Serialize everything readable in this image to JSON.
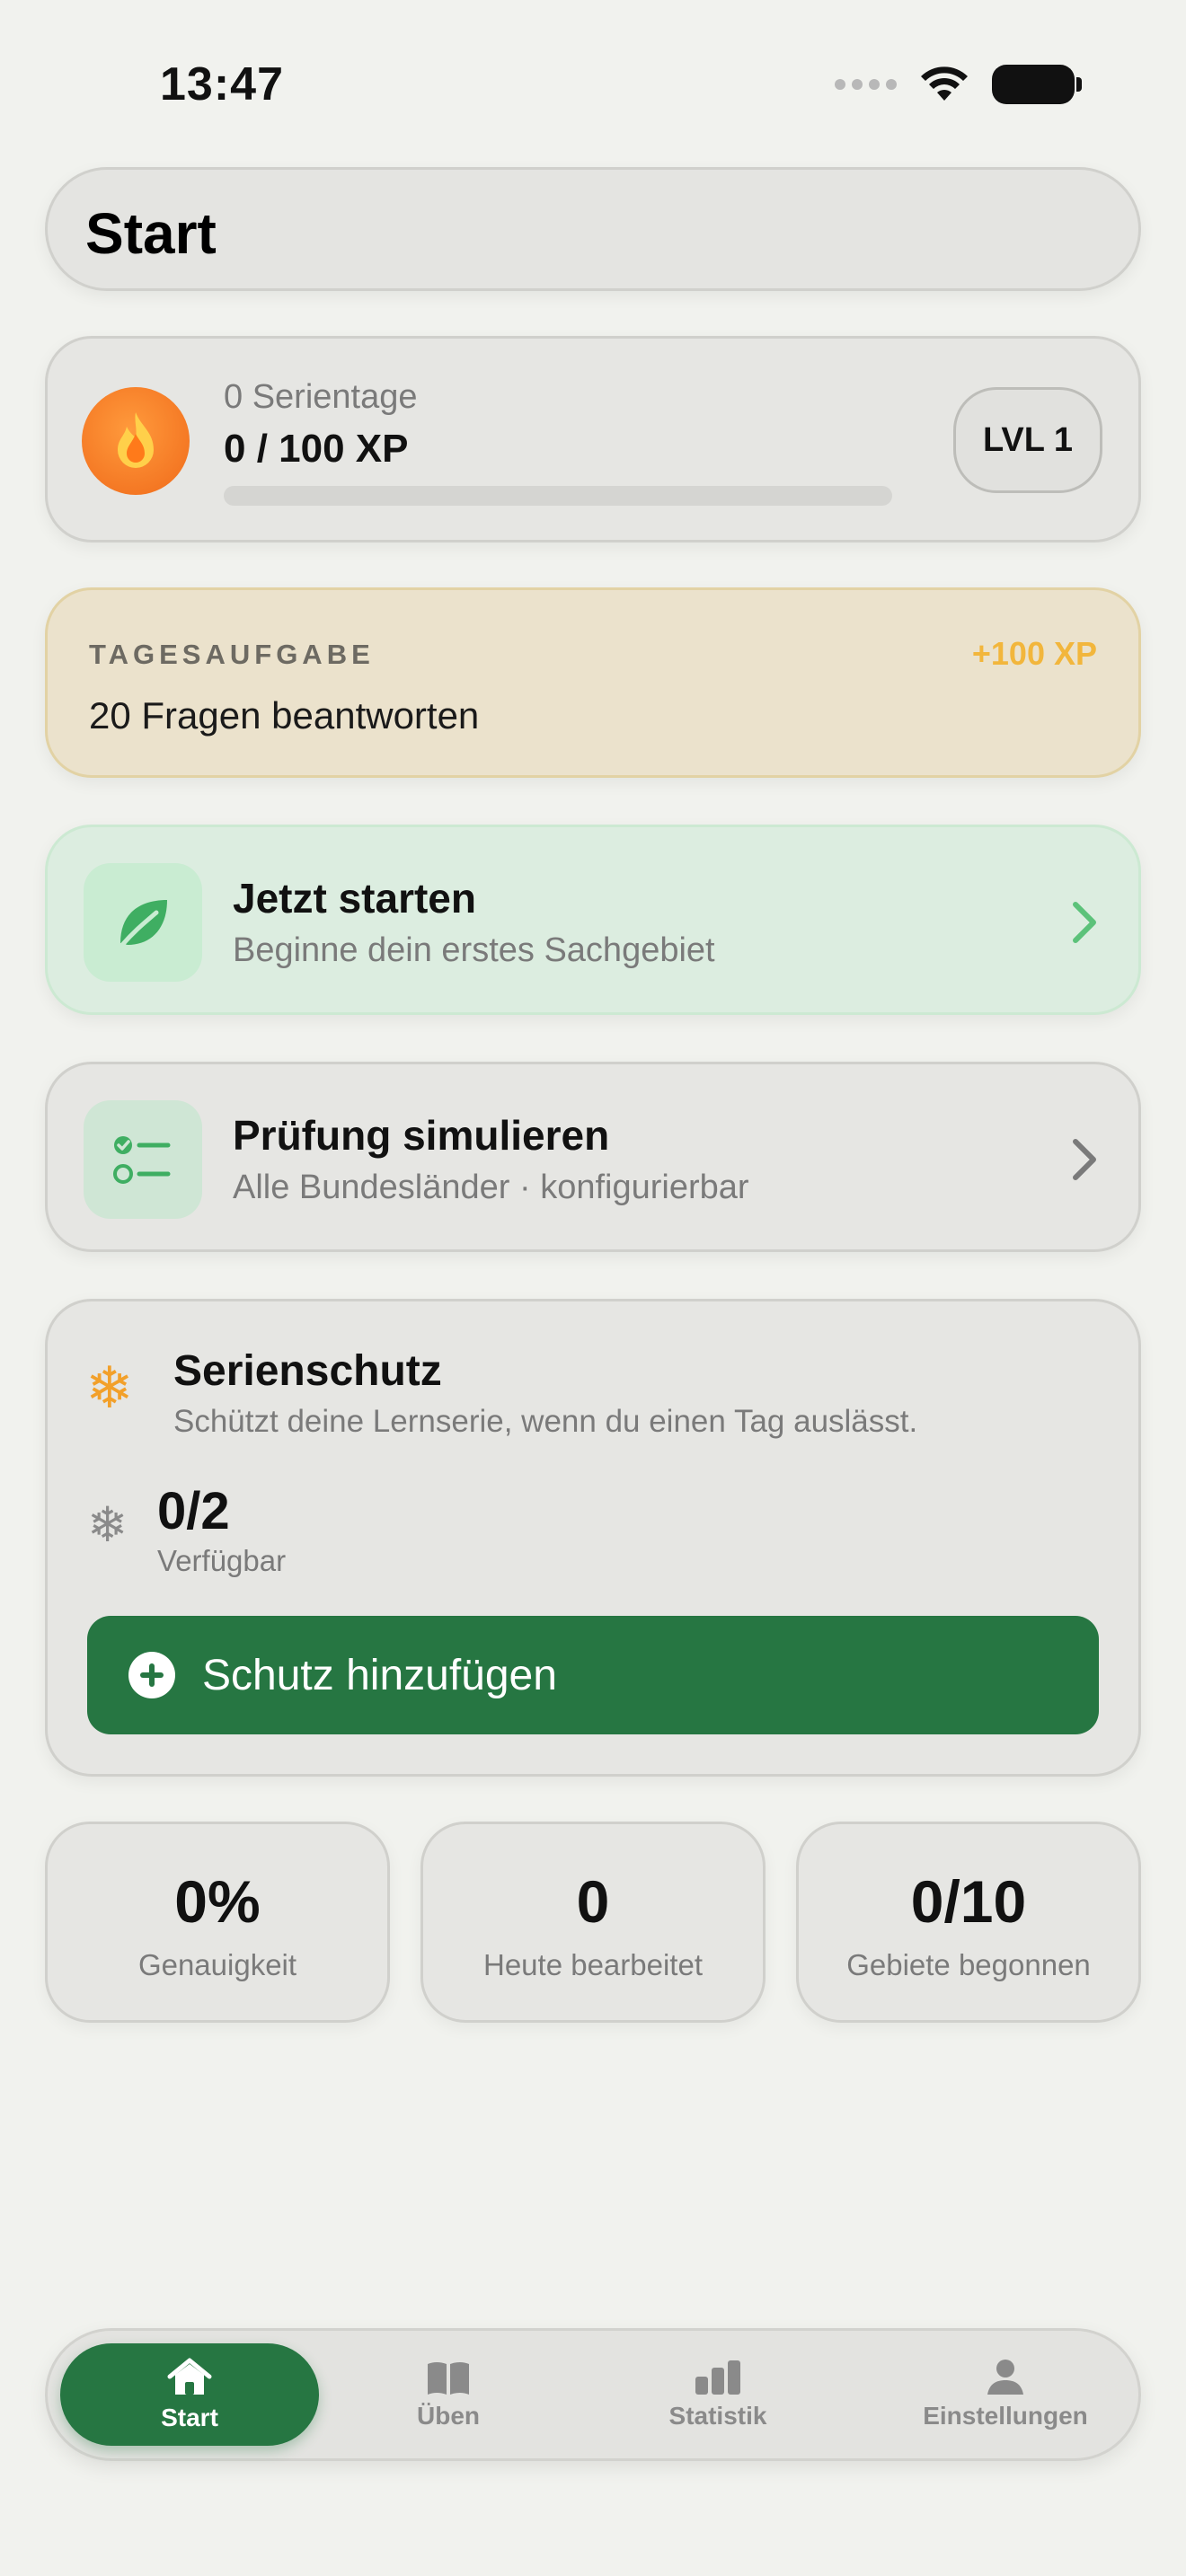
{
  "status_bar": {
    "time": "13:47"
  },
  "header": {
    "title": "Start"
  },
  "progress": {
    "streak_label": "0 Serientage",
    "xp_label": "0 / 100 XP",
    "xp_progress": 0,
    "level_label": "LVL 1"
  },
  "daily_task": {
    "eyebrow": "TAGESAUFGABE",
    "reward": "+100 XP",
    "title": "20 Fragen beantworten"
  },
  "start_now": {
    "title": "Jetzt starten",
    "subtitle": "Beginne dein erstes Sachgebiet",
    "icon": "leaf-icon"
  },
  "exam_sim": {
    "title": "Prüfung simulieren",
    "subtitle": "Alle Bundesländer · konfigurierbar",
    "icon": "checklist-icon"
  },
  "streak_freeze": {
    "title": "Serienschutz",
    "subtitle": "Schützt deine Lernserie, wenn du einen Tag auslässt.",
    "count": "0/2",
    "count_label": "Verfügbar",
    "button_label": "Schutz hinzufügen"
  },
  "stats": [
    {
      "value": "0%",
      "label": "Genauigkeit"
    },
    {
      "value": "0",
      "label": "Heute bearbeitet"
    },
    {
      "value": "0/10",
      "label": "Gebiete begonnen"
    }
  ],
  "tabbar": {
    "tabs": [
      {
        "label": "Start",
        "icon": "house-icon",
        "active": true
      },
      {
        "label": "Üben",
        "icon": "book-icon",
        "active": false
      },
      {
        "label": "Statistik",
        "icon": "bar-chart-icon",
        "active": false
      },
      {
        "label": "Einstellungen",
        "icon": "person-icon",
        "active": false
      }
    ]
  },
  "colors": {
    "accent_green": "#267642",
    "streak_orange": "#f07a22",
    "reward_yellow": "#f2b63c",
    "freeze_orange": "#f2a02a"
  }
}
